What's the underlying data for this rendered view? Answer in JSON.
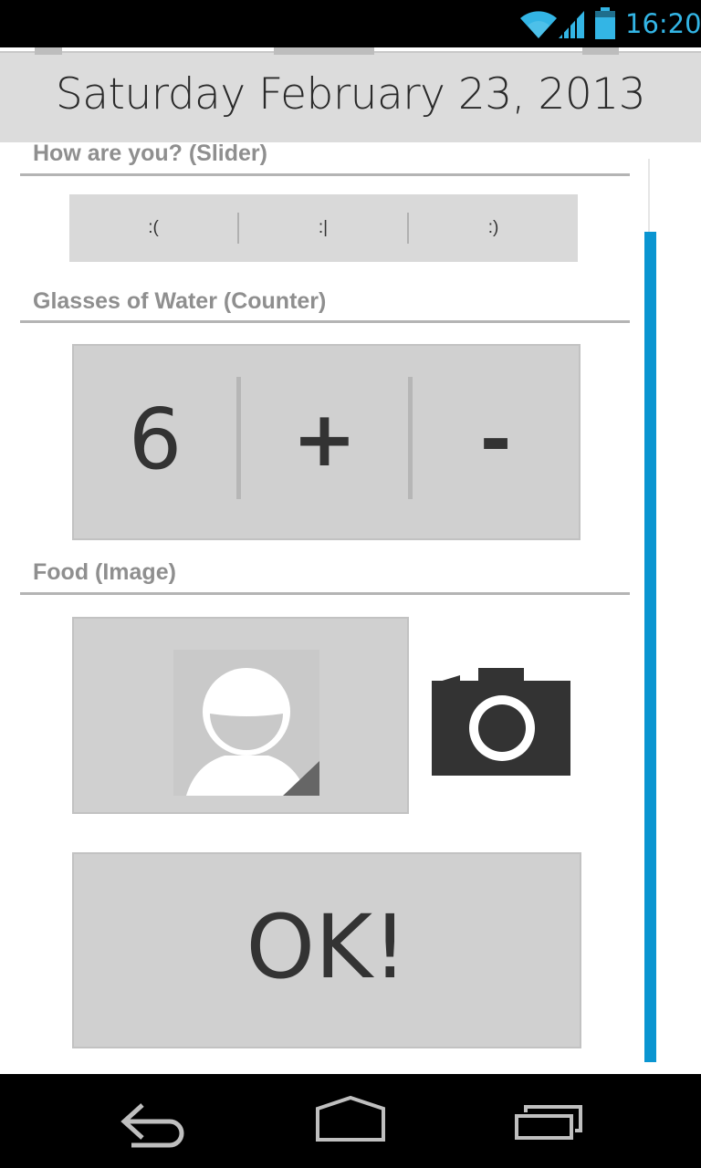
{
  "status_bar": {
    "time": "16:20",
    "icons": [
      "wifi-icon",
      "signal-icon",
      "battery-icon"
    ],
    "accent_color": "#33b5e5"
  },
  "header": {
    "date": "Saturday February 23, 2013"
  },
  "sections": {
    "mood": {
      "label": "How are you? (Slider)",
      "options": [
        ":(",
        ":|",
        ":)"
      ]
    },
    "water": {
      "label": "Glasses of Water (Counter)",
      "count": "6",
      "increment": "+",
      "decrement": "-"
    },
    "food": {
      "label": "Food (Image)",
      "icons": [
        "placeholder-person-icon",
        "camera-icon"
      ]
    }
  },
  "ok_button": {
    "label": "OK!"
  },
  "nav_bar": {
    "buttons": [
      "back-icon",
      "home-icon",
      "recent-apps-icon"
    ]
  },
  "colors": {
    "scroll_thumb": "#0a95d1",
    "panel_bg": "#d0d0d0",
    "header_bg": "#dcdcdc"
  }
}
